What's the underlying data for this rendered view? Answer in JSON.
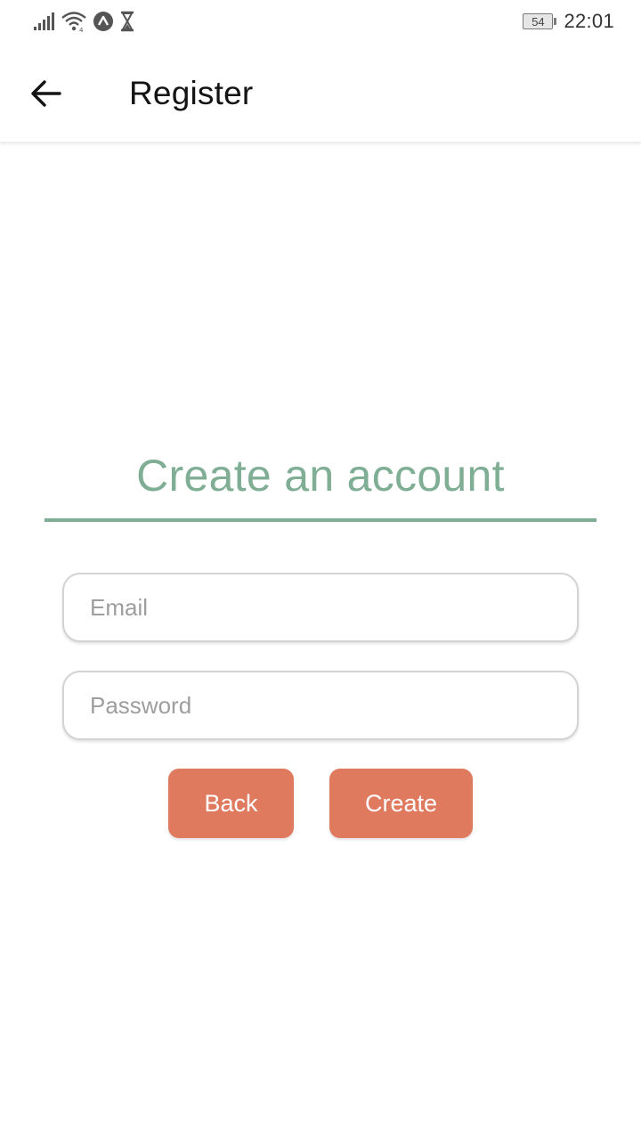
{
  "status_bar": {
    "battery_level": "54",
    "time": "22:01",
    "icons": [
      "signal-icon",
      "wifi-icon",
      "app-notification-icon",
      "hourglass-icon",
      "battery-icon"
    ]
  },
  "app_bar": {
    "title": "Register",
    "back_icon": "arrow-left-icon"
  },
  "form": {
    "heading": "Create an account",
    "email": {
      "placeholder": "Email",
      "value": ""
    },
    "password": {
      "placeholder": "Password",
      "value": ""
    },
    "back_label": "Back",
    "create_label": "Create"
  },
  "colors": {
    "accent_green": "#7fae95",
    "button_orange": "#e07a5f",
    "field_border": "#d3d3d3"
  }
}
